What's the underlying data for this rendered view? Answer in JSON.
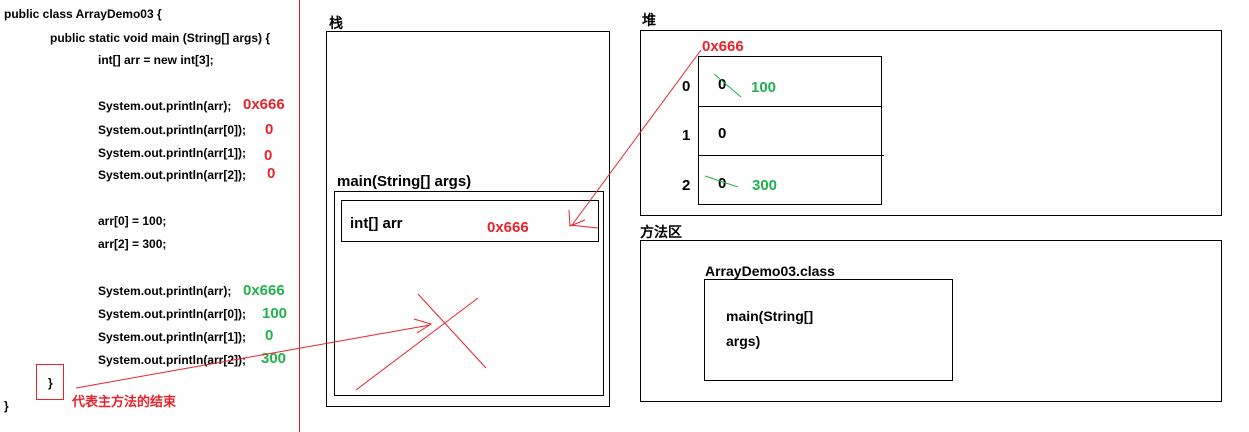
{
  "code": {
    "class_decl": "public class ArrayDemo03 {",
    "main_decl": "public static void main (String[] args) {",
    "arr_decl": "int[] arr = new int[3];",
    "print_block1": [
      {
        "stmt": "System.out.println(arr);",
        "value": "0x666"
      },
      {
        "stmt": "System.out.println(arr[0]);",
        "value": "0"
      },
      {
        "stmt": "System.out.println(arr[1]);",
        "value": "0"
      },
      {
        "stmt": "System.out.println(arr[2]);",
        "value": "0"
      }
    ],
    "assign0": "arr[0] = 100;",
    "assign2": "arr[2] = 300;",
    "print_block2": [
      {
        "stmt": "System.out.println(arr);",
        "value": "0x666"
      },
      {
        "stmt": "System.out.println(arr[0]);",
        "value": "100"
      },
      {
        "stmt": "System.out.println(arr[1]);",
        "value": "0"
      },
      {
        "stmt": "System.out.println(arr[2]);",
        "value": "300"
      }
    ],
    "method_close": "}",
    "class_close": "}",
    "end_note": "代表主方法的结束"
  },
  "stack": {
    "title": "栈",
    "frame_label": "main(String[] args)",
    "var_label": "int[] arr",
    "var_value": "0x666"
  },
  "heap": {
    "title": "堆",
    "address": "0x666",
    "cells": [
      {
        "index": "0",
        "old": "0",
        "new": "100"
      },
      {
        "index": "1",
        "old": "0",
        "new": ""
      },
      {
        "index": "2",
        "old": "0",
        "new": "300"
      }
    ]
  },
  "method_area": {
    "title": "方法区",
    "class_label": "ArrayDemo03.class",
    "method_line1": "main(String[]",
    "method_line2": "args)"
  },
  "colors": {
    "red": "#e8232a",
    "green": "#22b24c"
  }
}
